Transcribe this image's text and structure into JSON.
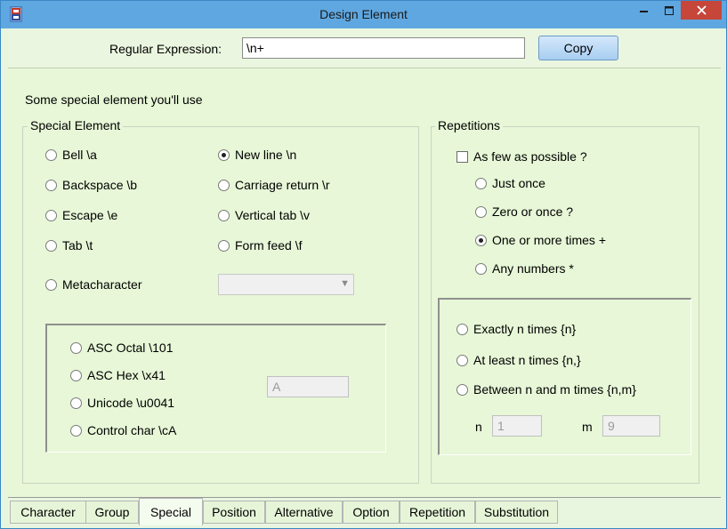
{
  "window": {
    "title": "Design Element",
    "icon": "app-logo-icon",
    "controls": {
      "minimize": "minimize-icon",
      "maximize": "maximize-icon",
      "close": "close-icon"
    }
  },
  "header": {
    "regex_label": "Regular Expression:",
    "regex_value": "\\n+",
    "copy_label": "Copy"
  },
  "intro_text": "Some special element you'll use",
  "special": {
    "title": "Special Element",
    "bell": "Bell  \\a",
    "backspace": "Backspace  \\b",
    "escape": "Escape  \\e",
    "tab": "Tab  \\t",
    "newline": "New line  \\n",
    "carriage": "Carriage return  \\r",
    "vtab": "Vertical tab  \\v",
    "formfeed": "Form feed  \\f",
    "metachar": "Metacharacter",
    "selected": "New line  \\n",
    "codes": {
      "octal": "ASC Octal  \\101",
      "hex": "ASC Hex  \\x41",
      "unicode": "Unicode  \\u0041",
      "control": "Control char  \\cA",
      "char_value": "A"
    }
  },
  "repetitions": {
    "title": "Repetitions",
    "few": "As few as possible  ?",
    "once": "Just once",
    "zero_once": "Zero or once  ?",
    "one_more": "One or more times  +",
    "any": "Any numbers  *",
    "selected": "One or more times  +",
    "exact": "Exactly n times  {n}",
    "least": "At least n times  {n,}",
    "between": "Between n and m times {n,m}",
    "n_label": "n",
    "n_value": "1",
    "m_label": "m",
    "m_value": "9"
  },
  "tabs": {
    "character": "Character",
    "group": "Group",
    "special": "Special",
    "position": "Position",
    "alternative": "Alternative",
    "option": "Option",
    "repetition": "Repetition",
    "substitution": "Substitution",
    "active": "Special"
  },
  "colors": {
    "titlebar": "#5fa7e0",
    "close_button": "#c7463a",
    "content_bg": "#e7f7d7"
  }
}
